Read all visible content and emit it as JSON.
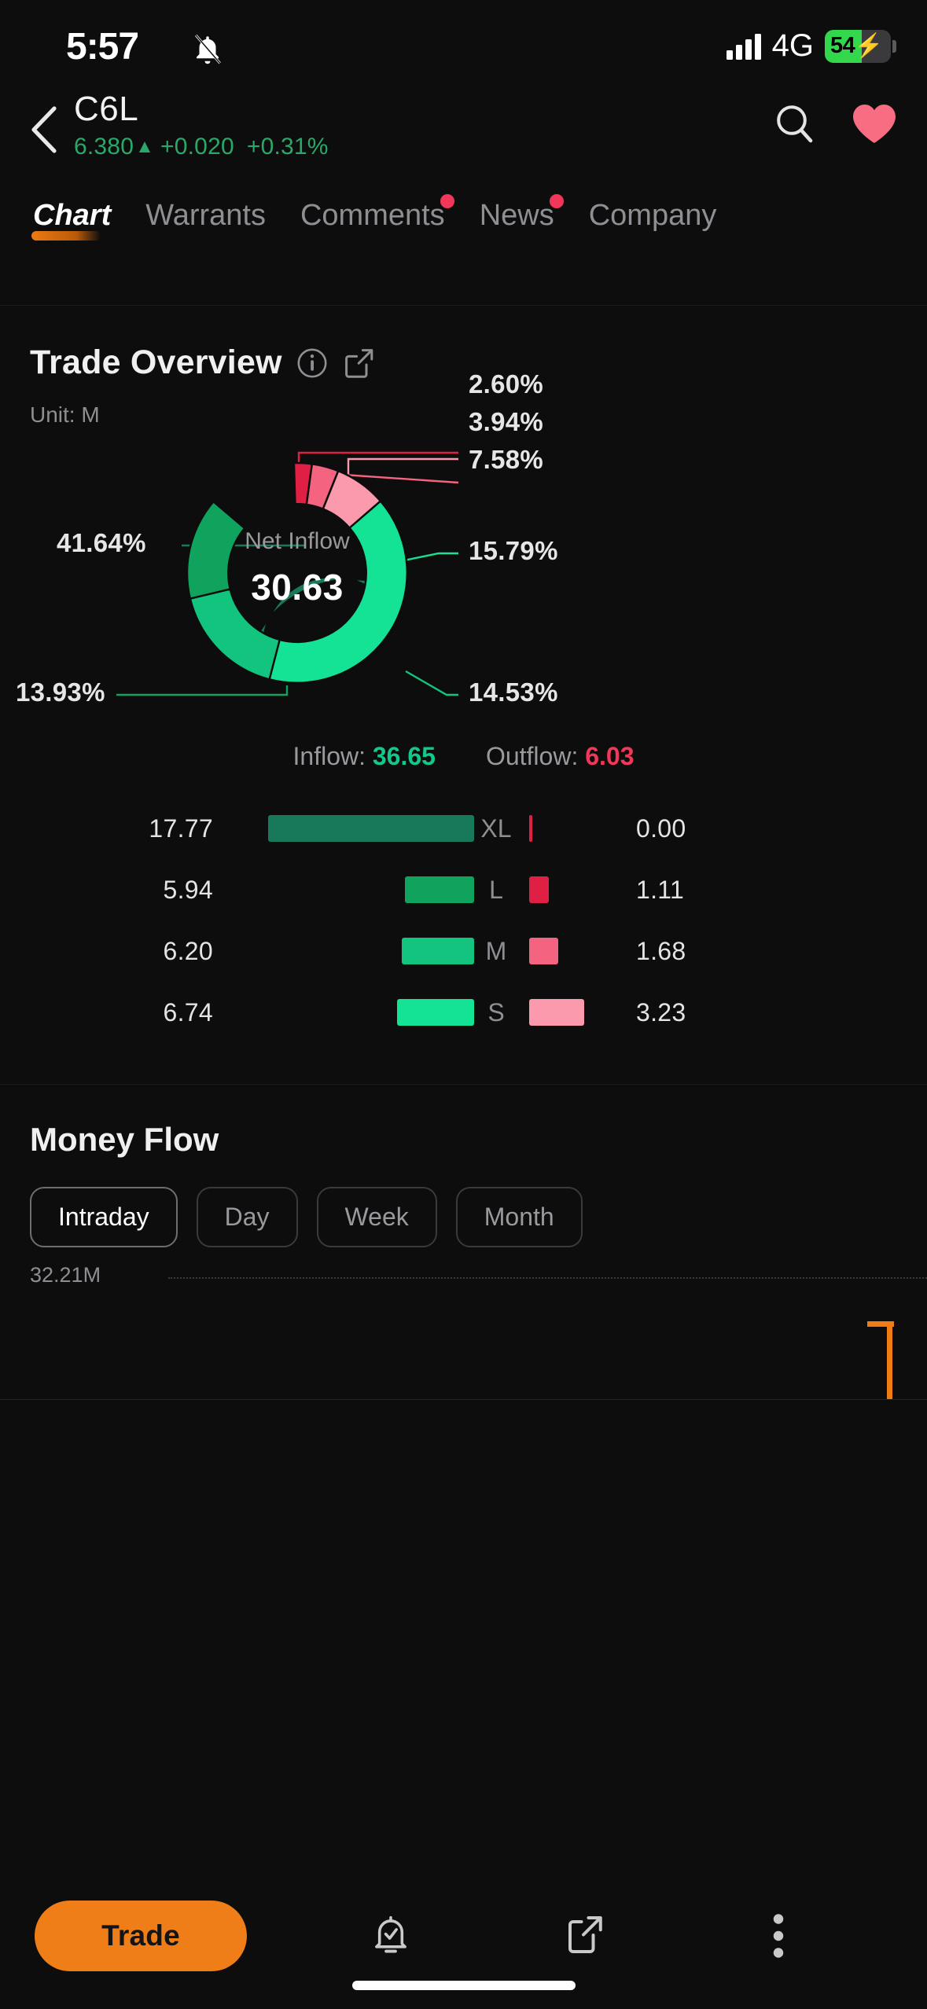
{
  "status_bar": {
    "time": "5:57",
    "silent_icon": "bell-slash-icon",
    "network": "4G",
    "battery_percent": "54",
    "battery_charging": true,
    "signal_icon": "cellular-signal-icon"
  },
  "header": {
    "back_icon": "chevron-left-icon",
    "ticker": "C6L",
    "price": "6.380",
    "direction_arrow": "▲",
    "change": "+0.020",
    "change_percent": "+0.31%",
    "up_color": "#2aa86a",
    "search_icon": "search-icon",
    "favorite_icon": "heart-icon",
    "favorite_color": "#f86d81"
  },
  "tabs": [
    {
      "label": "Chart",
      "active": true,
      "badge": false
    },
    {
      "label": "Warrants",
      "active": false,
      "badge": false
    },
    {
      "label": "Comments",
      "active": false,
      "badge": true
    },
    {
      "label": "News",
      "active": false,
      "badge": true
    },
    {
      "label": "Company",
      "active": false,
      "badge": false
    }
  ],
  "trade_overview": {
    "title": "Trade Overview",
    "info_icon": "info-circle-icon",
    "share_icon": "share-icon",
    "unit": "Unit: M",
    "center_caption": "Net Inflow",
    "center_value": "30.63",
    "inflow_label": "Inflow:",
    "inflow_value": "36.65",
    "outflow_label": "Outflow:",
    "outflow_value": "6.03",
    "bars": [
      {
        "category": "XL",
        "in_value": "17.77",
        "out_value": "0.00",
        "in_color": "#17795a",
        "out_color": "#e01f45",
        "in_width": 262,
        "out_width": 4
      },
      {
        "category": "L",
        "in_value": "5.94",
        "out_value": "1.11",
        "in_color": "#10a35e",
        "out_color": "#e01f45",
        "in_width": 88,
        "out_width": 25
      },
      {
        "category": "M",
        "in_value": "6.20",
        "out_value": "1.68",
        "in_color": "#12c47e",
        "out_color": "#f4637f",
        "in_width": 92,
        "out_width": 37
      },
      {
        "category": "S",
        "in_value": "6.74",
        "out_value": "3.23",
        "in_color": "#14e396",
        "out_color": "#fb9aac",
        "in_width": 98,
        "out_width": 70
      }
    ]
  },
  "chart_data": {
    "type": "pie",
    "title": "Trade Overview",
    "subtitle": "Unit: M",
    "center_label": "Net Inflow",
    "center_value": 30.63,
    "legend_position": "callout-labels",
    "slices": [
      {
        "name": "XL Inflow",
        "percent": 41.64,
        "label": "41.64%",
        "color": "#17795a",
        "value": 17.77,
        "side": "left"
      },
      {
        "name": "L Inflow",
        "percent": 13.93,
        "label": "13.93%",
        "color": "#10a35e",
        "value": 5.94,
        "side": "left"
      },
      {
        "name": "M Inflow",
        "percent": 14.53,
        "label": "14.53%",
        "color": "#12c47e",
        "value": 6.2,
        "side": "right"
      },
      {
        "name": "S Inflow",
        "percent": 15.79,
        "label": "15.79%",
        "color": "#14e396",
        "value": 6.74,
        "side": "right"
      },
      {
        "name": "S Outflow",
        "percent": 7.58,
        "label": "7.58%",
        "color": "#fb9aac",
        "value": 3.23,
        "side": "right"
      },
      {
        "name": "M Outflow",
        "percent": 3.94,
        "label": "3.94%",
        "color": "#f4637f",
        "value": 1.68,
        "side": "right"
      },
      {
        "name": "L Outflow",
        "percent": 2.6,
        "label": "2.60%",
        "color": "#e01f45",
        "value": 1.11,
        "side": "right"
      }
    ],
    "totals": {
      "inflow": 36.65,
      "outflow": 6.03,
      "net": 30.63
    }
  },
  "money_flow": {
    "title": "Money Flow",
    "chips": [
      {
        "label": "Intraday",
        "active": true
      },
      {
        "label": "Day",
        "active": false
      },
      {
        "label": "Week",
        "active": false
      },
      {
        "label": "Month",
        "active": false
      }
    ],
    "axis_max_label": "32.21M",
    "bar_color": "#f07c14"
  },
  "bottom_bar": {
    "trade_label": "Trade",
    "alert_icon": "bell-check-icon",
    "share_icon": "share-icon",
    "more_icon": "more-vertical-icon",
    "accent_color": "#ef7d18"
  }
}
